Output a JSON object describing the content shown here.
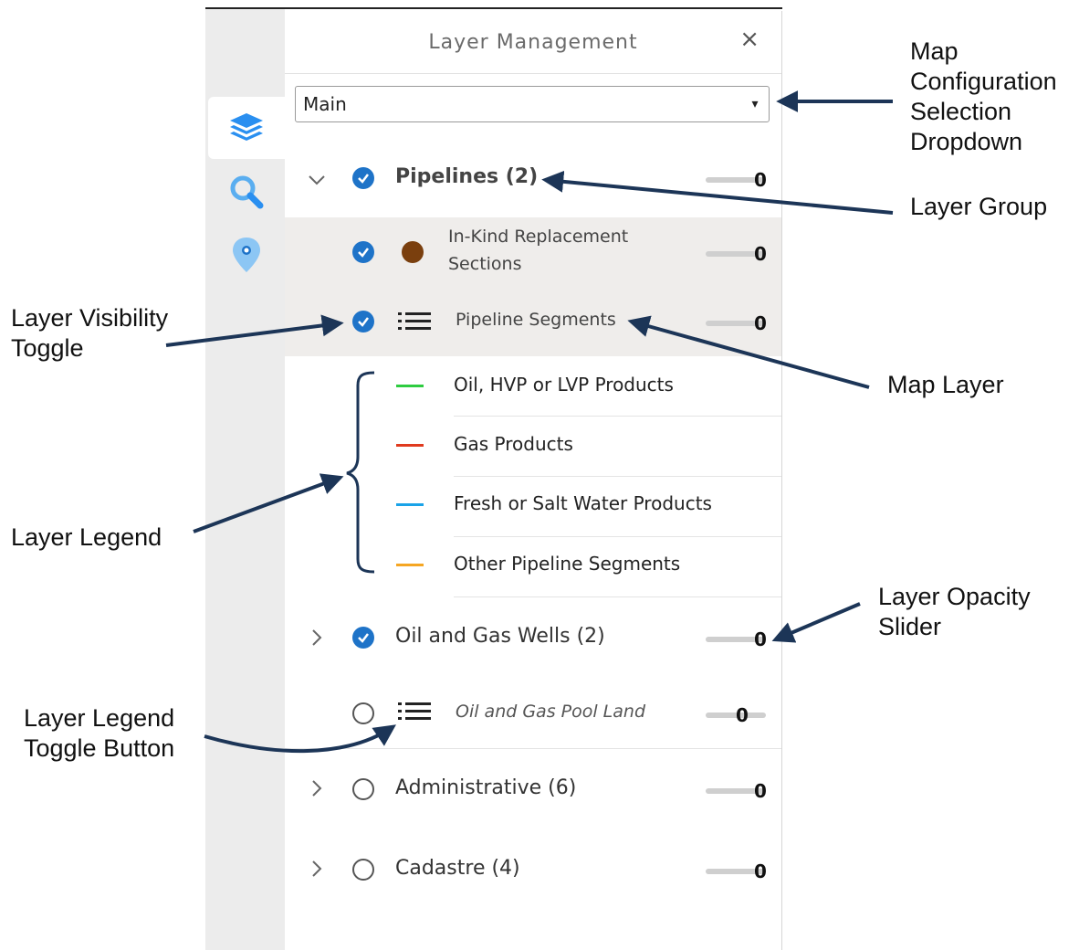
{
  "panel": {
    "title": "Layer Management",
    "close_glyph": "×",
    "config_select": {
      "value": "Main",
      "caret": "▾"
    }
  },
  "side_tabs": [
    {
      "icon": "layers-icon",
      "active": true
    },
    {
      "icon": "search-icon",
      "active": false
    },
    {
      "icon": "location-pin-icon",
      "active": false
    }
  ],
  "tree": {
    "group_pipelines": {
      "label": "Pipelines (2)",
      "checked": true,
      "expanded": true,
      "opacity": "0"
    },
    "layer_inkind": {
      "label_line1": "In-Kind Replacement",
      "label_line2": "Sections",
      "checked": true,
      "opacity": "0"
    },
    "layer_segments": {
      "label": "Pipeline Segments",
      "checked": true,
      "opacity": "0"
    },
    "legend": [
      {
        "label": "Oil, HVP or LVP Products",
        "color": "#2ecc40"
      },
      {
        "label": "Gas Products",
        "color": "#e03a1e"
      },
      {
        "label": "Fresh or Salt Water Products",
        "color": "#1aa3e8"
      },
      {
        "label": "Other Pipeline Segments",
        "color": "#f5a623"
      }
    ],
    "group_wells": {
      "label": "Oil and Gas Wells (2)",
      "checked": true,
      "expanded": false,
      "opacity": "0"
    },
    "layer_pool": {
      "label": "Oil and Gas Pool Land",
      "checked": false,
      "opacity": "0"
    },
    "group_admin": {
      "label": "Administrative (6)",
      "checked": false,
      "expanded": false,
      "opacity": "0"
    },
    "group_cadastre": {
      "label": "Cadastre (4)",
      "checked": false,
      "expanded": false,
      "opacity": "0"
    }
  },
  "annotations": {
    "map_config": [
      "Map",
      "Configuration",
      "Selection",
      "Dropdown"
    ],
    "layer_group": "Layer Group",
    "visibility": [
      "Layer Visibility",
      "Toggle"
    ],
    "map_layer": "Map Layer",
    "legend": "Layer Legend",
    "opacity": [
      "Layer Opacity",
      "Slider"
    ],
    "legend_toggle": [
      "Layer Legend",
      "Toggle Button"
    ]
  },
  "colors": {
    "accent": "#1e73c8",
    "inkind_dot": "#7a3f0e",
    "arrow": "#1c3557"
  }
}
